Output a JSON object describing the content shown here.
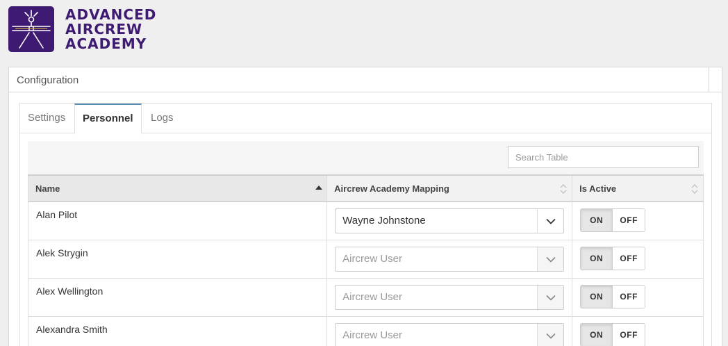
{
  "brand": {
    "line1": "ADVANCED",
    "line2": "AIRCREW",
    "line3": "ACADEMY",
    "color": "#3e1a72"
  },
  "panel": {
    "title": "Configuration"
  },
  "tabs": [
    {
      "label": "Settings",
      "active": false
    },
    {
      "label": "Personnel",
      "active": true
    },
    {
      "label": "Logs",
      "active": false
    }
  ],
  "search": {
    "placeholder": "Search Table"
  },
  "table": {
    "columns": [
      "Name",
      "Aircrew Academy Mapping",
      "Is Active"
    ],
    "rows": [
      {
        "name": "Alan Pilot",
        "mapping": "Wayne Johnstone",
        "mapping_is_placeholder": false,
        "on": "ON",
        "off": "OFF"
      },
      {
        "name": "Alek Strygin",
        "mapping": "Aircrew User",
        "mapping_is_placeholder": true,
        "on": "ON",
        "off": "OFF"
      },
      {
        "name": "Alex Wellington",
        "mapping": "Aircrew User",
        "mapping_is_placeholder": true,
        "on": "ON",
        "off": "OFF"
      },
      {
        "name": "Alexandra Smith",
        "mapping": "Aircrew User",
        "mapping_is_placeholder": true,
        "on": "ON",
        "off": "OFF"
      }
    ]
  },
  "colors": {
    "tab_accent": "#5a8fb3",
    "border": "#dddddd"
  }
}
